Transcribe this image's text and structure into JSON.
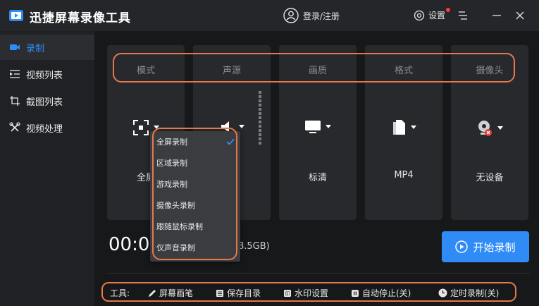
{
  "app": {
    "title": "迅捷屏幕录像工具"
  },
  "header": {
    "login_label": "登录/注册",
    "settings_label": "设置"
  },
  "sidebar": {
    "items": [
      {
        "label": "录制",
        "icon": "camera-icon"
      },
      {
        "label": "视频列表",
        "icon": "list-icon"
      },
      {
        "label": "截图列表",
        "icon": "screenshot-icon"
      },
      {
        "label": "视频处理",
        "icon": "tools-icon"
      }
    ]
  },
  "panels": [
    {
      "header": "模式",
      "value": "全屏",
      "icon": "fullscreen-icon"
    },
    {
      "header": "声源",
      "value": "",
      "icon": "speaker-icon"
    },
    {
      "header": "画质",
      "value": "标清",
      "icon": "monitor-icon"
    },
    {
      "header": "格式",
      "value": "MP4",
      "icon": "file-icon"
    },
    {
      "header": "摄像头",
      "value": "无设备",
      "icon": "webcam-icon"
    }
  ],
  "mode_dropdown": {
    "options": [
      "全屏录制",
      "区域录制",
      "游戏录制",
      "摄像头录制",
      "跟随鼠标录制",
      "仅声音录制"
    ],
    "selected": "全屏录制"
  },
  "recording": {
    "timer": "00:00",
    "storage_suffix": "8.5GB)"
  },
  "start_button": {
    "label": "开始录制"
  },
  "tools": {
    "label": "工具:",
    "items": [
      {
        "label": "屏幕画笔",
        "icon": "pen-icon"
      },
      {
        "label": "保存目录",
        "icon": "folder-icon"
      },
      {
        "label": "水印设置",
        "icon": "watermark-icon"
      },
      {
        "label": "自动停止(关)",
        "icon": "pause-icon"
      },
      {
        "label": "定时录制(关)",
        "icon": "clock-icon"
      }
    ]
  },
  "colors": {
    "accent": "#2f8cf7",
    "highlight": "#e6784b",
    "background": "#1f2124",
    "panel": "#27292c"
  }
}
